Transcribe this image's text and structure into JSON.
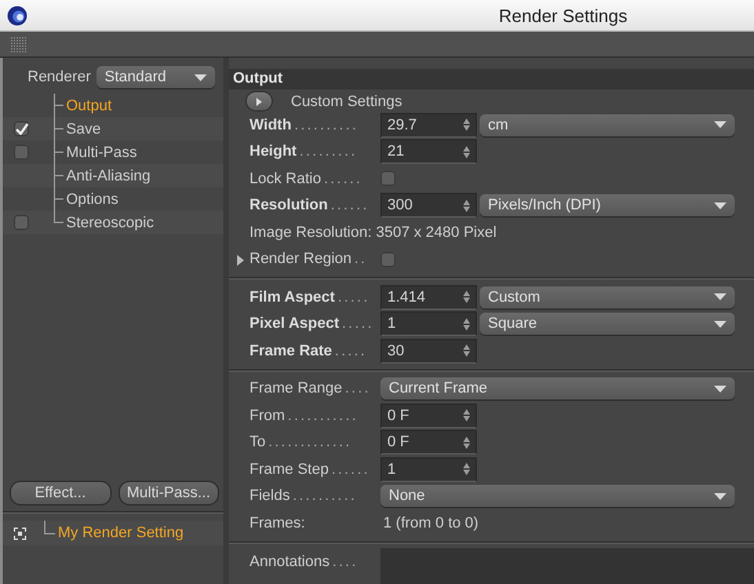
{
  "window": {
    "title": "Render Settings"
  },
  "renderer": {
    "label": "Renderer",
    "value": "Standard"
  },
  "nav_items": [
    {
      "label": "Output",
      "selected": true,
      "kind": "plain"
    },
    {
      "label": "Save",
      "selected": false,
      "kind": "check",
      "checked": true
    },
    {
      "label": "Multi-Pass",
      "selected": false,
      "kind": "check",
      "checked": false
    },
    {
      "label": "Anti-Aliasing",
      "selected": false,
      "kind": "plain"
    },
    {
      "label": "Options",
      "selected": false,
      "kind": "plain"
    },
    {
      "label": "Stereoscopic",
      "selected": false,
      "kind": "check",
      "checked": false
    }
  ],
  "sidebar_buttons": [
    "Effect...",
    "Multi-Pass..."
  ],
  "presets": [
    {
      "label": "My Render Setting",
      "selected": true
    }
  ],
  "section": {
    "title": "Output",
    "preset_button": "Custom Settings"
  },
  "groups": [
    [
      {
        "kind": "number",
        "label": "Width",
        "leader": "..........",
        "bold": true,
        "value": "29.7",
        "dropdown": "cm"
      },
      {
        "kind": "number",
        "label": "Height",
        "leader": ".........",
        "bold": true,
        "value": "21"
      },
      {
        "kind": "checkbox",
        "label": "Lock Ratio",
        "leader": "......",
        "bold": false,
        "checked": false
      },
      {
        "kind": "number",
        "label": "Resolution",
        "leader": "......",
        "bold": true,
        "value": "300",
        "dropdown": "Pixels/Inch (DPI)"
      },
      {
        "kind": "line",
        "label": "Image Resolution: 3507 x 2480 Pixel"
      },
      {
        "kind": "checkbox",
        "label": "Render Region",
        "leader": "..",
        "bold": false,
        "checked": false,
        "expanded": false
      }
    ],
    [
      {
        "kind": "number",
        "label": "Film Aspect",
        "leader": ".....",
        "bold": true,
        "value": "1.414",
        "dropdown": "Custom"
      },
      {
        "kind": "number",
        "label": "Pixel Aspect",
        "leader": ".....",
        "bold": true,
        "value": "1",
        "dropdown": "Square"
      },
      {
        "kind": "number",
        "label": "Frame Rate",
        "leader": ".....",
        "bold": true,
        "value": "30"
      }
    ],
    [
      {
        "kind": "dropdown",
        "label": "Frame Range",
        "leader": "....",
        "bold": false,
        "value": "Current Frame"
      },
      {
        "kind": "number",
        "label": "From",
        "leader": "...........",
        "bold": false,
        "value": "0 F"
      },
      {
        "kind": "number",
        "label": "To",
        "leader": ".............",
        "bold": false,
        "value": "0 F"
      },
      {
        "kind": "number",
        "label": "Frame Step",
        "leader": "......",
        "bold": false,
        "value": "1"
      },
      {
        "kind": "dropdown",
        "label": "Fields",
        "leader": "..........",
        "bold": false,
        "value": "None"
      },
      {
        "kind": "info",
        "label": "Frames:",
        "value": "1 (from 0 to 0)"
      }
    ],
    [
      {
        "kind": "textarea",
        "label": "Annotations",
        "leader": "....",
        "bold": false
      }
    ]
  ]
}
